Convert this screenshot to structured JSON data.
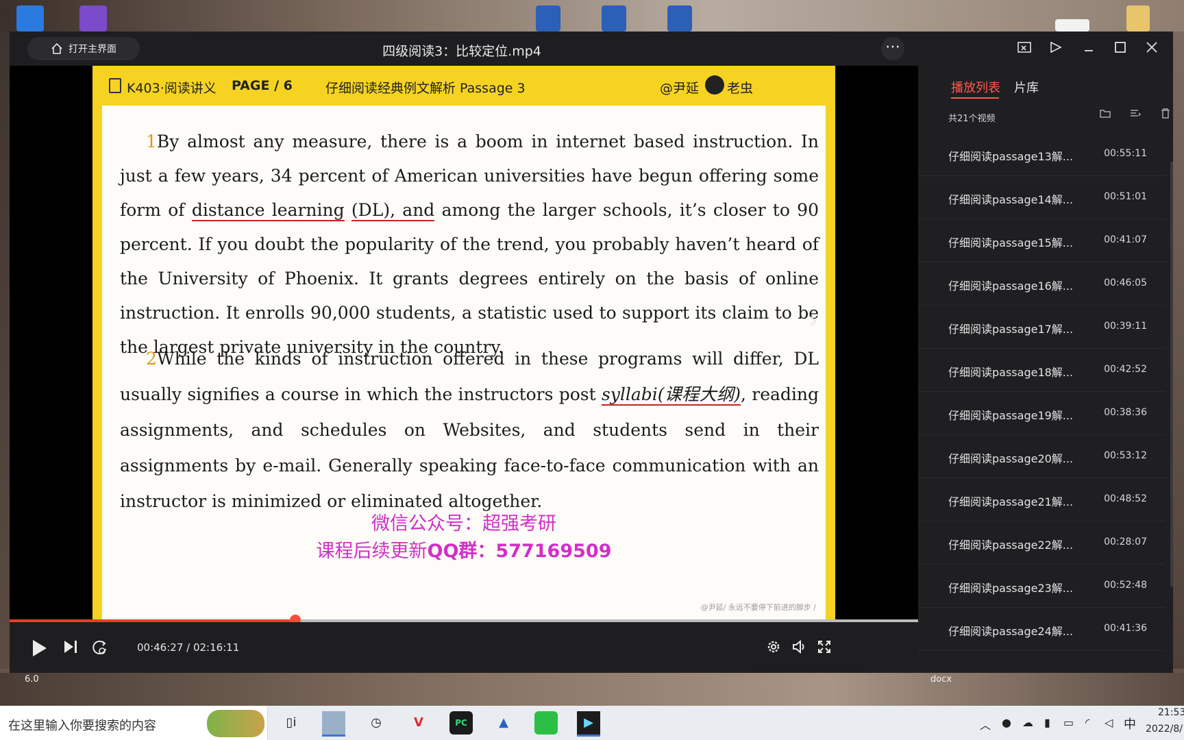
{
  "window": {
    "home_label": "打开主界面",
    "title": "四级阅读3：比较定位.mp4"
  },
  "slide": {
    "header_left": "K403·阅读讲义",
    "header_page": "PAGE / 6",
    "header_center": "仔细阅读经典例文解析 Passage 3",
    "header_right": "@尹延",
    "header_right2": "老虫",
    "p1_num": "1",
    "p1_a": "By almost any measure, there is a boom in internet based instruction. In just a few years, 34 percent of American universities have begun offering some form of ",
    "p1_ul1": "distance learning",
    "p1_sp": " ",
    "p1_ul2": "(DL), and",
    "p1_b": " among the larger schools, it’s closer to 90 percent. If you doubt the popularity of the trend, you probably haven’t heard of the University of Phoenix. It grants degrees entirely on the basis of online instruction. It enrolls 90,000 students, a statistic used to support its claim to be the largest private university in the country.",
    "p2_num": "2",
    "p2_a": "While the kinds of instruction offered in these programs will differ, DL usually signifies a course in which the instructors post ",
    "p2_ul": "syllabi(课程大纲)",
    "p2_b": ", reading assignments, and schedules on Websites, and students send in their assignments by e-mail. Generally speaking face-to-face communication with an instructor is minimized or eliminated altogether.",
    "wechat_line1": "微信公众号：超强考研",
    "wechat_line2_a": "课程后续更新",
    "wechat_line2_b": "QQ群：577169509",
    "watermark": "@尹延/ 永远不要停下前进的脚步 /"
  },
  "sidebar": {
    "tab_playlist": "播放列表",
    "tab_library": "片库",
    "count": "共21个视频",
    "items": [
      {
        "name": "仔细阅读passage13解...",
        "duration": "00:55:11"
      },
      {
        "name": "仔细阅读passage14解...",
        "duration": "00:51:01"
      },
      {
        "name": "仔细阅读passage15解...",
        "duration": "00:41:07"
      },
      {
        "name": "仔细阅读passage16解...",
        "duration": "00:46:05"
      },
      {
        "name": "仔细阅读passage17解...",
        "duration": "00:39:11"
      },
      {
        "name": "仔细阅读passage18解...",
        "duration": "00:42:52"
      },
      {
        "name": "仔细阅读passage19解...",
        "duration": "00:38:36"
      },
      {
        "name": "仔细阅读passage20解...",
        "duration": "00:53:12"
      },
      {
        "name": "仔细阅读passage21解...",
        "duration": "00:48:52"
      },
      {
        "name": "仔细阅读passage22解...",
        "duration": "00:28:07"
      },
      {
        "name": "仔细阅读passage23解...",
        "duration": "00:52:48"
      },
      {
        "name": "仔细阅读passage24解...",
        "duration": "00:41:36"
      }
    ]
  },
  "controls": {
    "time": "00:46:27 / 02:16:11",
    "progress": 0.3148
  },
  "taskbar": {
    "search_placeholder": "在这里输入你要搜索的内容",
    "ime": "中",
    "clock_time": "21:53",
    "clock_date": "2022/8/"
  },
  "desktop": {
    "label_left": "6.0",
    "label_right": "docx"
  },
  "colors": {
    "accent": "#ff5a48",
    "slide_yellow": "#f5d320",
    "wechat_magenta": "#d22fc8"
  }
}
